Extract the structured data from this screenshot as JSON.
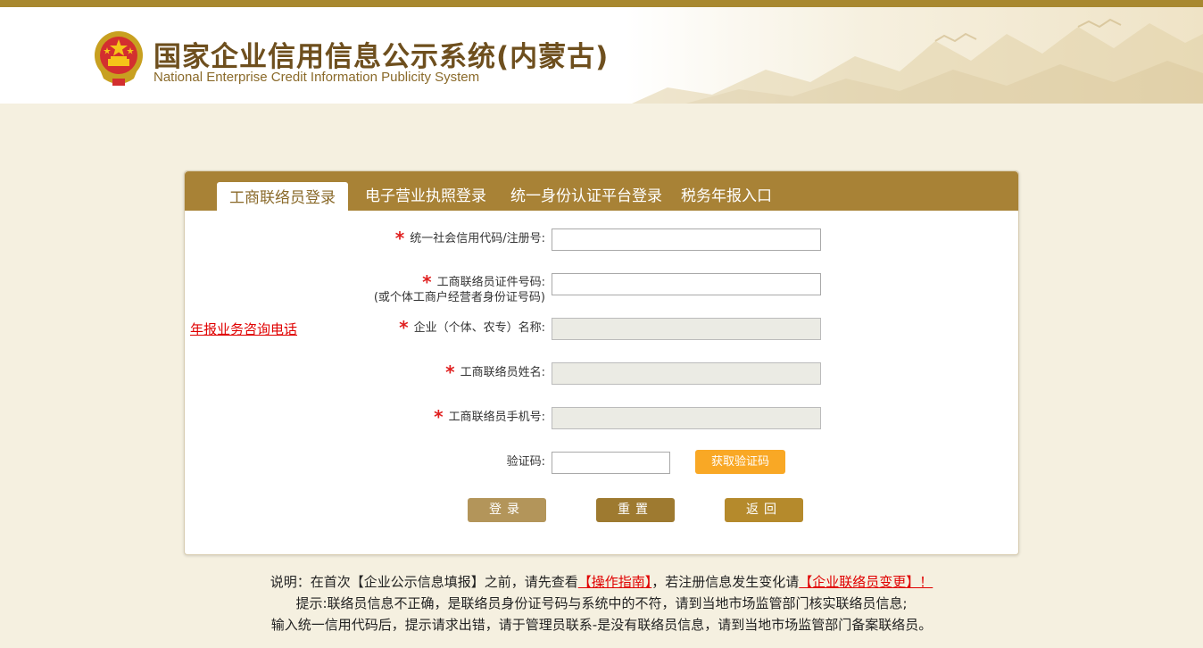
{
  "header": {
    "title_cn": "国家企业信用信息公示系统(内蒙古)",
    "title_en": "National Enterprise Credit Information Publicity System"
  },
  "tabs": [
    {
      "label": "工商联络员登录",
      "active": true
    },
    {
      "label": "电子营业执照登录",
      "active": false
    },
    {
      "label": "统一身份认证平台登录",
      "active": false
    },
    {
      "label": "税务年报入口",
      "active": false
    }
  ],
  "side_link": "年报业务咨询电话",
  "form": {
    "required_mark": "*",
    "credit_code_label": "统一社会信用代码/注册号:",
    "credit_code_value": "",
    "id_label_line1": "工商联络员证件号码:",
    "id_label_line2": "(或个体工商户经营者身份证号码)",
    "id_value": "",
    "company_name_label": "企业（个体、农专）名称:",
    "company_name_value": "",
    "liaison_name_label": "工商联络员姓名:",
    "liaison_name_value": "",
    "liaison_phone_label": "工商联络员手机号:",
    "liaison_phone_value": "",
    "captcha_label": "验证码:",
    "captcha_value": "",
    "get_captcha_button": "获取验证码"
  },
  "buttons": {
    "login": "登录",
    "reset": "重置",
    "back": "返回"
  },
  "notes": {
    "line1_prefix": "说明：在首次【企业公示信息填报】之前，请先查看",
    "line1_guide_link": "【操作指南】",
    "line1_middle": "，若注册信息发生变化请",
    "line1_change_link": "【企业联络员变更】！",
    "line2": "提示:联络员信息不正确，是联络员身份证号码与系统中的不符，请到当地市场监管部门核实联络员信息;",
    "line3": "输入统一信用代码后，提示请求出错，请于管理员联系-是没有联络员信息，请到当地市场监管部门备案联络员。"
  },
  "colors": {
    "brand": "#a88236",
    "background": "#f5f0e0",
    "required": "#e02020",
    "link": "#e00000",
    "captcha_button": "#f9a825",
    "login_button": "#b3955a",
    "reset_button": "#9e7a30",
    "back_button": "#b58a2c"
  }
}
